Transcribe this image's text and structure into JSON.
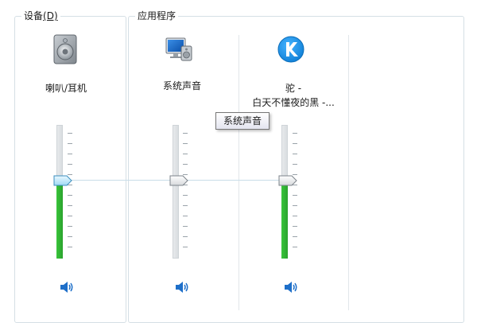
{
  "devices": {
    "title": "设备",
    "mnemonic": "(D)",
    "channels": [
      {
        "label": "喇叭/耳机",
        "level": 0.58,
        "icon": "speaker-device-icon"
      }
    ]
  },
  "applications": {
    "title": "应用程序",
    "channels": [
      {
        "label": "系统声音",
        "level": 0.58,
        "meter_level": 0,
        "icon": "system-sounds-icon"
      },
      {
        "label_line1": "驼 -",
        "label_line2": "白天不懂夜的黑 -...",
        "level": 0.58,
        "meter_level": 0.58,
        "icon": "kugou-k-icon"
      }
    ]
  },
  "tooltip": {
    "text": "系统声音"
  },
  "colors": {
    "meter_green": "#2fb52f",
    "thumb_active": "#d8f0fb",
    "link_line": "#c9dce8",
    "speaker_blue": "#1e6fc9",
    "app_k_blue": "#1a8fe3"
  }
}
